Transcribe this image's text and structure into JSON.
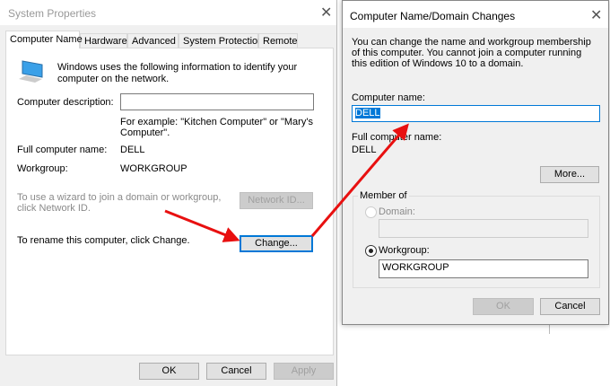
{
  "system_properties": {
    "title": "System Properties",
    "tabs": [
      "Computer Name",
      "Hardware",
      "Advanced",
      "System Protection",
      "Remote"
    ],
    "intro": "Windows uses the following information to identify your computer on the network.",
    "description_label": "Computer description:",
    "description_value": "",
    "example": "For example: \"Kitchen Computer\" or \"Mary's Computer\".",
    "full_name_label": "Full computer name:",
    "full_name_value": "DELL",
    "workgroup_label": "Workgroup:",
    "workgroup_value": "WORKGROUP",
    "network_text": "To use a wizard to join a domain or workgroup, click Network ID.",
    "network_button": "Network ID...",
    "rename_text": "To rename this computer, click Change.",
    "change_button": "Change...",
    "ok": "OK",
    "cancel": "Cancel",
    "apply": "Apply"
  },
  "name_dialog": {
    "title": "Computer Name/Domain Changes",
    "intro": "You can change the name and workgroup membership of this computer. You cannot join a computer running this edition of Windows 10 to a domain.",
    "computer_name_label": "Computer name:",
    "computer_name_value": "DELL",
    "full_name_label": "Full computer name:",
    "full_name_value": "DELL",
    "more_button": "More...",
    "member_of": "Member of",
    "domain_label": "Domain:",
    "domain_value": "",
    "workgroup_label": "Workgroup:",
    "workgroup_value": "WORKGROUP",
    "selected": "workgroup",
    "ok": "OK",
    "cancel": "Cancel"
  },
  "colors": {
    "accent": "#0078d7",
    "arrow": "#e81010",
    "selection": "#0078d7"
  }
}
